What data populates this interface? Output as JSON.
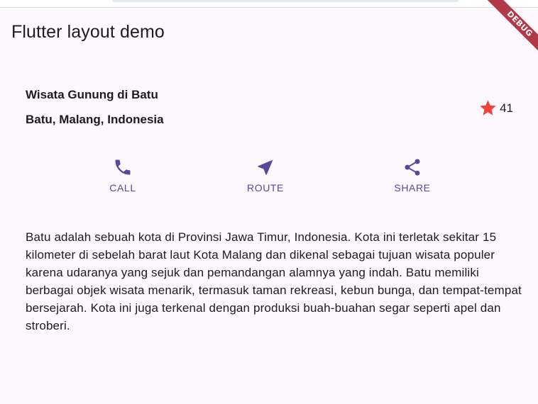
{
  "app": {
    "title": "Flutter layout demo",
    "debug_banner": "DEBUG"
  },
  "title_section": {
    "name": "Wisata Gunung di Batu",
    "location": "Batu, Malang, Indonesia",
    "rating": {
      "icon": "star-icon",
      "count": "41",
      "color": "#f44336"
    }
  },
  "actions": {
    "color": "#5a479c",
    "items": [
      {
        "icon": "call-icon",
        "label": "CALL"
      },
      {
        "icon": "route-icon",
        "label": "ROUTE"
      },
      {
        "icon": "share-icon",
        "label": "SHARE"
      }
    ]
  },
  "description": "Batu adalah sebuah kota di Provinsi Jawa Timur, Indonesia. Kota ini terletak sekitar 15 kilometer di sebelah barat laut Kota Malang dan dikenal sebagai tujuan wisata populer karena udaranya yang sejuk dan pemandangan alamnya yang indah. Batu memiliki berbagai objek wisata menarik, termasuk taman rekreasi, kebun bunga, dan tempat-tempat bersejarah. Kota ini juga terkenal dengan produksi buah-buahan segar seperti apel dan stroberi.",
  "theme": {
    "background": "#fdf7fe",
    "debug_banner": "#b23a48"
  }
}
